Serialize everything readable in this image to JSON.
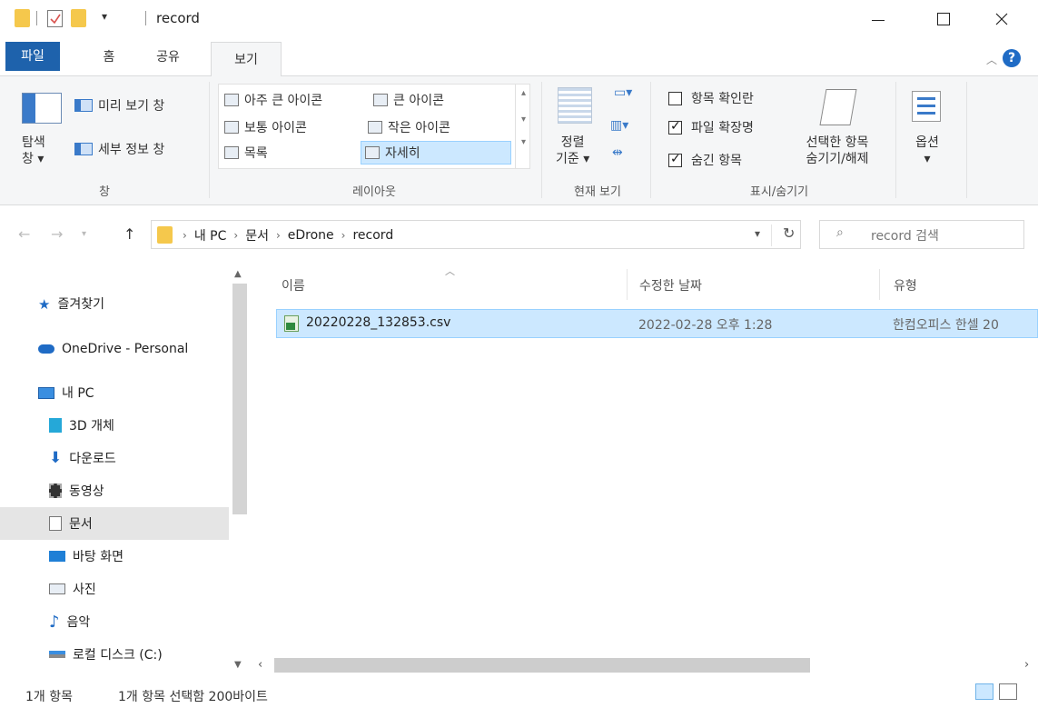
{
  "window": {
    "title": "record",
    "qat_dropdown": "▾"
  },
  "ribbon_tabs": {
    "file": "파일",
    "home": "홈",
    "share": "공유",
    "view": "보기"
  },
  "ribbon": {
    "panes_group": {
      "nav_pane_line1": "탐색",
      "nav_pane_line2": "창 ▾",
      "preview_pane": "미리 보기 창",
      "details_pane": "세부 정보 창",
      "label": "창"
    },
    "layout_group": {
      "extra_large_icons": "아주 큰 아이콘",
      "large_icons": "큰 아이콘",
      "medium_icons": "보통 아이콘",
      "small_icons": "작은 아이콘",
      "list": "목록",
      "details": "자세히",
      "label": "레이아웃",
      "selected": "자세히"
    },
    "current_view_group": {
      "sort_line1": "정렬",
      "sort_line2": "기준 ▾",
      "label": "현재 보기"
    },
    "show_hide_group": {
      "item_checkboxes": "항목 확인란",
      "file_extensions": "파일 확장명",
      "hidden_items": "숨긴 항목",
      "hide_selected_line1": "선택한 항목",
      "hide_selected_line2": "숨기기/해제",
      "label": "표시/숨기기",
      "item_checkboxes_checked": false,
      "file_extensions_checked": true,
      "hidden_items_checked": true
    },
    "options": {
      "label": "옵션",
      "arrow": "▾"
    }
  },
  "address": {
    "crumbs": [
      "내 PC",
      "문서",
      "eDrone",
      "record"
    ],
    "search_placeholder": "record 검색"
  },
  "nav_pane": {
    "items": [
      {
        "label": "즐겨찾기",
        "icon": "star-icon"
      },
      {
        "label": "OneDrive - Personal",
        "icon": "cloud-icon"
      },
      {
        "label": "내 PC",
        "icon": "computer-icon"
      },
      {
        "label": "3D 개체",
        "icon": "cube-icon"
      },
      {
        "label": "다운로드",
        "icon": "download-icon"
      },
      {
        "label": "동영상",
        "icon": "video-icon"
      },
      {
        "label": "문서",
        "icon": "document-icon"
      },
      {
        "label": "바탕 화면",
        "icon": "desktop-icon"
      },
      {
        "label": "사진",
        "icon": "picture-icon"
      },
      {
        "label": "음악",
        "icon": "music-icon"
      },
      {
        "label": "로컬 디스크 (C:)",
        "icon": "drive-icon"
      }
    ],
    "selected": "문서"
  },
  "file_list": {
    "columns": [
      "이름",
      "수정한 날짜",
      "유형"
    ],
    "rows": [
      {
        "name": "20220228_132853.csv",
        "modified": "2022-02-28 오후 1:28",
        "type": "한컴오피스 한셀 20",
        "selected": true
      }
    ]
  },
  "status": {
    "item_count": "1개 항목",
    "selection": "1개 항목 선택함 200바이트"
  },
  "colors": {
    "accent": "#1e62ac",
    "selection": "#cce8ff",
    "folder": "#f5c84c"
  }
}
